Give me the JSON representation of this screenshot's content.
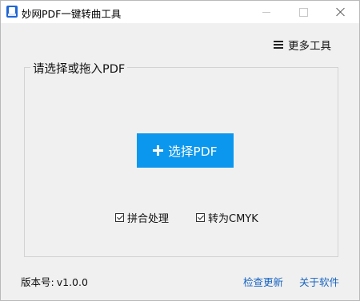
{
  "window": {
    "title": "妙网PDF一键转曲工具"
  },
  "header": {
    "more_tools_label": "更多工具"
  },
  "main": {
    "group_label": "请选择或拖入PDF",
    "select_button_label": "选择PDF",
    "options": [
      {
        "label": "拼合处理",
        "checked": true
      },
      {
        "label": "转为CMYK",
        "checked": true
      }
    ]
  },
  "footer": {
    "version_label": "版本号:",
    "version_value": "v1.0.0",
    "check_update_label": "检查更新",
    "about_label": "关于软件"
  },
  "colors": {
    "accent": "#0c97ee",
    "link": "#1764c2",
    "background": "#f0f0f0"
  },
  "icons": {
    "app": "pdf-app-icon",
    "menu": "hamburger-menu-icon",
    "add": "plus-icon",
    "check": "checkmark-icon"
  }
}
